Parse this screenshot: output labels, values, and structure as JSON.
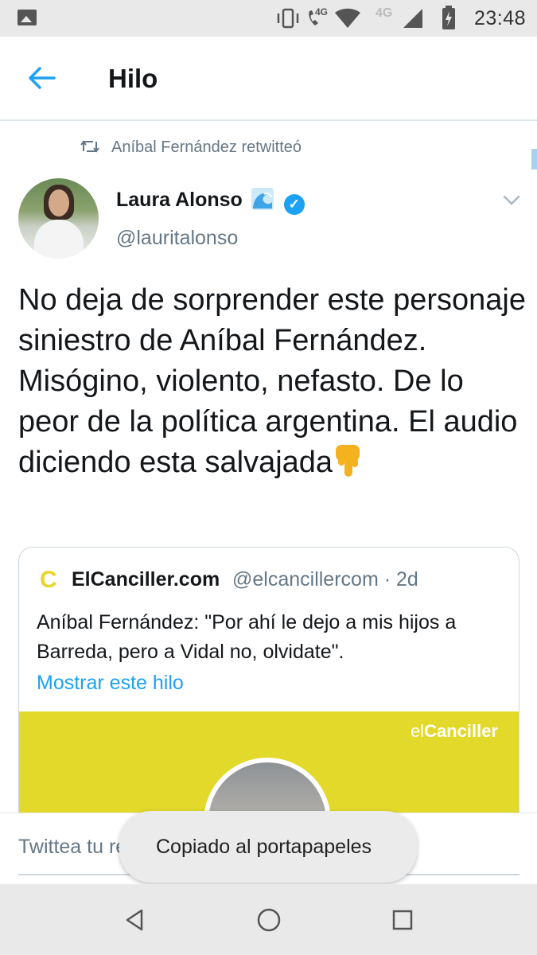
{
  "status_bar": {
    "network_label": "4G",
    "network_label_2": "4G",
    "time": "23:48"
  },
  "header": {
    "title": "Hilo"
  },
  "tweet": {
    "retweeted_by": "Aníbal Fernández retwitteó",
    "author_name": "Laura Alonso",
    "author_handle": "@lauritalonso",
    "text": "No deja de sorprender este personaje siniestro de Aníbal Fernández. Misógino, violento, nefasto. De lo peor de la política argentina. El audio diciendo esta salvajada"
  },
  "quoted_tweet": {
    "logo_letter": "C",
    "name": "ElCanciller.com",
    "handle_time": "@elcancillercom · 2d",
    "text": "Aníbal Fernández: \"Por ahí le dejo a mis hijos a Barreda, pero a Vidal no, olvidate\".",
    "show_thread": "Mostrar este hilo",
    "image_brand_prefix": "el",
    "image_brand_suffix": "Canciller"
  },
  "reply": {
    "placeholder": "Twittea tu res"
  },
  "toast": {
    "message": "Copiado al portapapeles"
  },
  "colors": {
    "accent": "#1da1f2",
    "muted": "#657786",
    "quote_image_bg": "#e2d92a"
  },
  "icons": {
    "back": "arrow-left-icon",
    "retweet": "retweet-icon",
    "verified": "verified-badge-icon",
    "caret": "chevron-down-icon"
  }
}
